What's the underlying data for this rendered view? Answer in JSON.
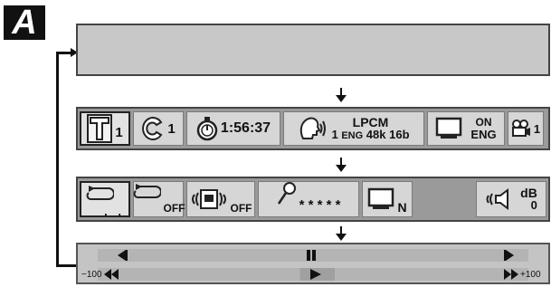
{
  "section_label": "A",
  "info_bar": {
    "title_value": "1",
    "chapter_value": "1",
    "elapsed_time": "1:56:37",
    "audio": {
      "format": "LPCM",
      "track": "1",
      "language": "ENG",
      "sample_rate": "48k",
      "bit_depth": "16b"
    },
    "subtitle": {
      "state": "ON",
      "language": "ENG"
    },
    "angle_value": "1"
  },
  "settings_bar": {
    "repeat_ab_marks": ". .",
    "repeat_state": "OFF",
    "surround_state": "OFF",
    "marker_stars": "* * * * *",
    "picture_mode": "N",
    "volume_unit": "dB",
    "volume_value": "0"
  },
  "transport_bar": {
    "reverse_speed_label": "−100",
    "forward_speed_label": "+100"
  }
}
